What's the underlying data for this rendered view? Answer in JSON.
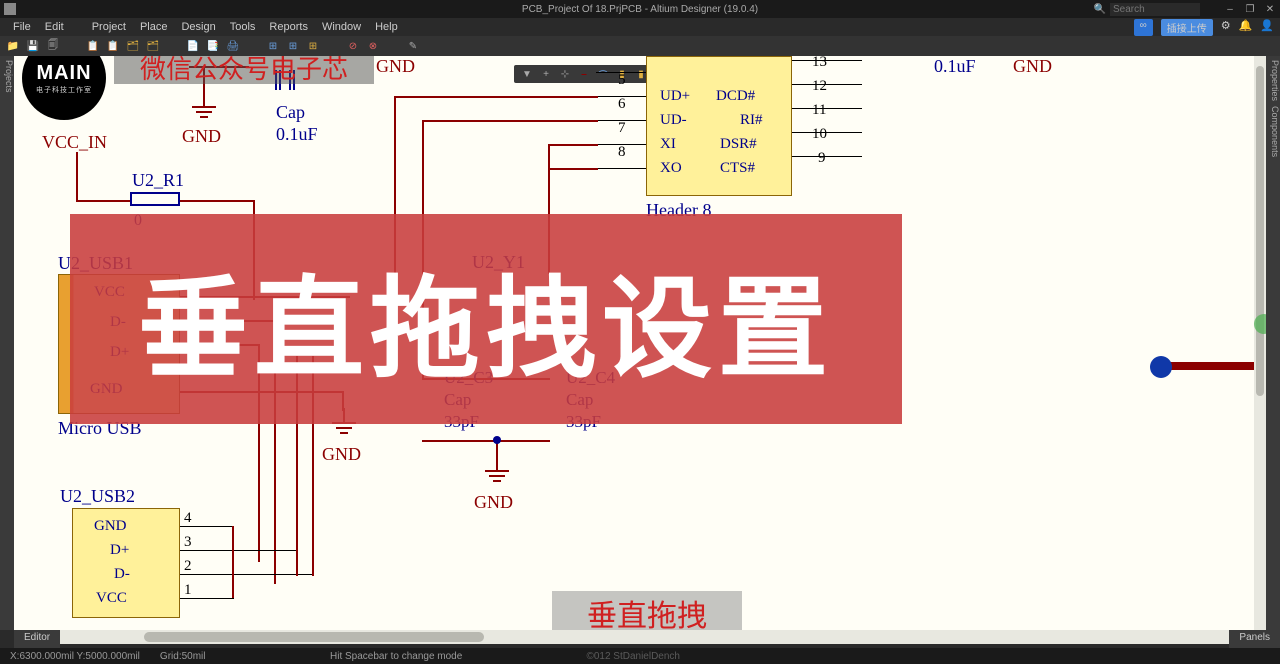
{
  "title_bar": {
    "title": "PCB_Project Of 18.PrjPCB - Altium Designer (19.0.4)",
    "search_placeholder": "Search",
    "window_controls": {
      "min": "‒",
      "max": "❐",
      "close": "✕"
    }
  },
  "menu": {
    "items": [
      "File",
      "Edit",
      "",
      "Project",
      "Place",
      "Design",
      "Tools",
      "Reports",
      "Window",
      "Help"
    ],
    "right_icons": [
      "⚙",
      "🔔",
      "👤"
    ],
    "share_badge": "∞",
    "share_cn_label": "插接上传"
  },
  "toolbar_main": {
    "icons": [
      "📁",
      "💾",
      "🗐",
      "",
      "📋",
      "📋",
      "🗂",
      "🗂",
      "",
      "📄",
      "📑",
      "🖨",
      "",
      "⊞",
      "⊞",
      "⊞",
      "",
      "⊘",
      "⊗",
      "",
      "✎"
    ]
  },
  "left_panel": {
    "label": "Projects"
  },
  "right_panel": {
    "labels": [
      "Properties",
      "Components"
    ]
  },
  "floating_toolbar": {
    "icons": [
      "▼",
      "+",
      "⊹",
      "⎯",
      "⌒",
      "▮",
      "▮",
      "⊞",
      "⎮",
      "⊡",
      "⊡",
      "⊡",
      "⊡",
      "⊡"
    ]
  },
  "schematic": {
    "gnd_text": "GND",
    "cap_c1": {
      "ref": "Cap",
      "val": "0.1uF"
    },
    "cap_c2_val": "0.1uF",
    "vcc_in": "VCC_IN",
    "r1": {
      "ref": "U2_R1",
      "val": "0"
    },
    "usb1": {
      "ref": "U2_USB1",
      "pins": [
        "VCC",
        "D-",
        "D+",
        "GND"
      ],
      "desig": "Micro USB"
    },
    "usb2": {
      "ref": "U2_USB2",
      "pins": [
        "GND",
        "D+",
        "D-",
        "VCC"
      ],
      "nums": [
        "4",
        "3",
        "2",
        "1"
      ]
    },
    "ic": {
      "pins_left_num": [
        "5",
        "6",
        "7",
        "8"
      ],
      "pins_left_name": [
        "UD+",
        "UD-",
        "XI",
        "XO"
      ],
      "pins_right_name": [
        "DCD#",
        "RI#",
        "DSR#",
        "CTS#"
      ],
      "header_pins": [
        "13",
        "12",
        "11",
        "10",
        "9"
      ],
      "desig": "Header 8"
    },
    "xtal": {
      "ref": "U2_Y1"
    },
    "cap_c3": {
      "ref": "U2_C3",
      "name": "Cap",
      "val": "33pF"
    },
    "cap_c4": {
      "ref": "U2_C4",
      "name": "Cap",
      "val": "33pF"
    }
  },
  "overlay": {
    "banner": "垂直拖拽设置",
    "small": "垂直拖拽"
  },
  "branding": {
    "logo_main": "MAIN",
    "logo_sub": "电子科技工作室",
    "chip_tag": "微信公众号电子芯"
  },
  "editor_tab": "Editor",
  "panels_tab": "Panels",
  "statusbar": {
    "coords": "X:6300.000mil Y:5000.000mil",
    "grid": "Grid:50mil",
    "hint": "Hit Spacebar to change mode",
    "brand": "©012 StDanielDench"
  }
}
